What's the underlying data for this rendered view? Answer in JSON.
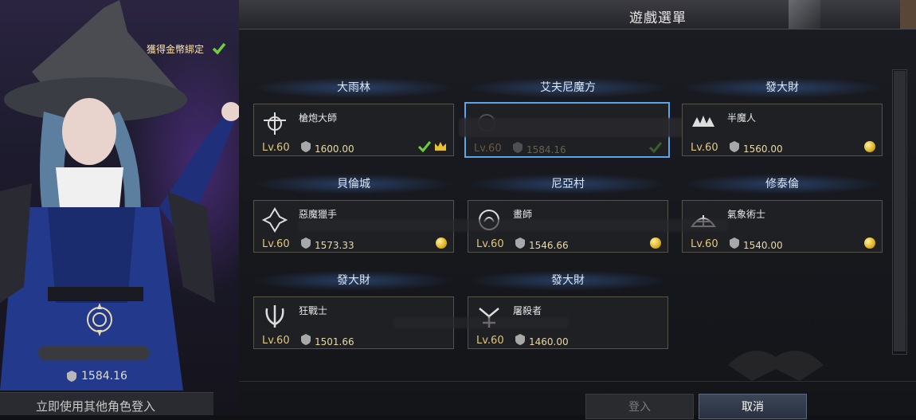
{
  "window": {
    "title": "遊戲選單"
  },
  "current_character": {
    "gold_bind_label": "獲得金幣綁定",
    "gear_score": "1584.16"
  },
  "switch_character_label": "立即使用其他角色登入",
  "buttons": {
    "login": "登入",
    "cancel": "取消"
  },
  "characters": [
    {
      "server": "大雨林",
      "class": "槍炮大師",
      "level": "Lv.60",
      "gear_score": "1600.00",
      "badge": "check-crown"
    },
    {
      "server": "艾夫尼魔方",
      "class": "",
      "level": "Lv.60",
      "gear_score": "1584.16",
      "badge": "check",
      "selected": true
    },
    {
      "server": "發大財",
      "class": "半魔人",
      "level": "Lv.60",
      "gear_score": "1560.00",
      "badge": "coin"
    },
    {
      "server": "貝倫城",
      "class": "惡魔獵手",
      "level": "Lv.60",
      "gear_score": "1573.33",
      "badge": "coin"
    },
    {
      "server": "尼亞村",
      "class": "畫師",
      "level": "Lv.60",
      "gear_score": "1546.66",
      "badge": "coin"
    },
    {
      "server": "修泰倫",
      "class": "氣象術士",
      "level": "Lv.60",
      "gear_score": "1540.00",
      "badge": "coin"
    },
    {
      "server": "發大財",
      "class": "狂戰士",
      "level": "Lv.60",
      "gear_score": "1501.66",
      "badge": "none"
    },
    {
      "server": "發大財",
      "class": "屠殺者",
      "level": "Lv.60",
      "gear_score": "1460.00",
      "badge": "none"
    }
  ],
  "colors": {
    "selected_border": "#5aa6e8",
    "level_text": "#e2c77a",
    "button_primary": "#3b4656"
  }
}
